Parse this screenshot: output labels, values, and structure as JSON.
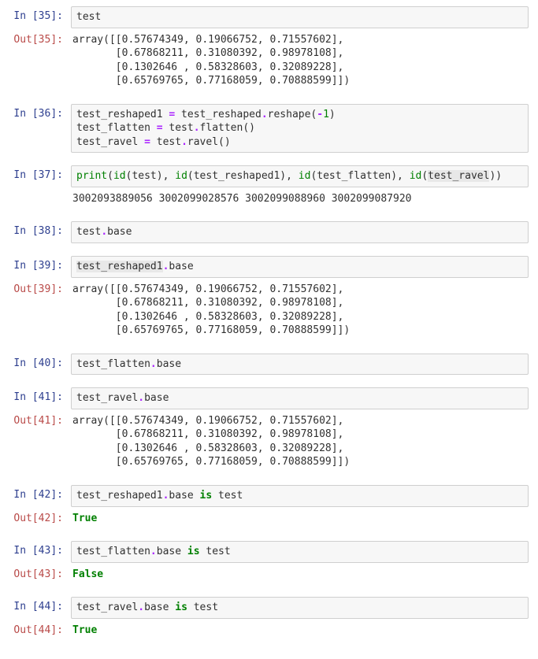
{
  "cells": [
    {
      "n": 35,
      "in_prompt": "In [35]:",
      "out_prompt": "Out[35]:",
      "code_tokens": [
        [
          "nm",
          "test"
        ]
      ],
      "output_tokens": [
        [
          "nm",
          "array([[0.57674349, 0.19066752, 0.71557602],\n       [0.67868211, 0.31080392, 0.98978108],\n       [0.1302646 , 0.58328603, 0.32089228],\n       [0.65769765, 0.77168059, 0.70888599]])"
        ]
      ]
    },
    {
      "n": 36,
      "in_prompt": "In [36]:",
      "code_tokens": [
        [
          "nm",
          "test_reshaped1 "
        ],
        [
          "op",
          "="
        ],
        [
          "nm",
          " test_reshaped"
        ],
        [
          "op",
          "."
        ],
        [
          "nm",
          "reshape("
        ],
        [
          "op",
          "-"
        ],
        [
          "num",
          "1"
        ],
        [
          "nm",
          ")\n"
        ],
        [
          "nm",
          "test_flatten "
        ],
        [
          "op",
          "="
        ],
        [
          "nm",
          " test"
        ],
        [
          "op",
          "."
        ],
        [
          "nm",
          "flatten()\n"
        ],
        [
          "nm",
          "test_ravel "
        ],
        [
          "op",
          "="
        ],
        [
          "nm",
          " test"
        ],
        [
          "op",
          "."
        ],
        [
          "nm",
          "ravel()"
        ]
      ]
    },
    {
      "n": 37,
      "in_prompt": "In [37]:",
      "code_tokens": [
        [
          "bi",
          "print"
        ],
        [
          "nm",
          "("
        ],
        [
          "bi",
          "id"
        ],
        [
          "nm",
          "(test), "
        ],
        [
          "bi",
          "id"
        ],
        [
          "nm",
          "(test_reshaped1), "
        ],
        [
          "bi",
          "id"
        ],
        [
          "nm",
          "(test_flatten), "
        ],
        [
          "bi",
          "id"
        ],
        [
          "nm",
          "("
        ],
        [
          "hl",
          "test_ravel"
        ],
        [
          "nm",
          "))"
        ]
      ],
      "stream_tokens": [
        [
          "nm",
          "3002093889056 3002099028576 3002099088960 3002099087920"
        ]
      ]
    },
    {
      "n": 38,
      "in_prompt": "In [38]:",
      "code_tokens": [
        [
          "nm",
          "test"
        ],
        [
          "op",
          "."
        ],
        [
          "nm",
          "base"
        ]
      ]
    },
    {
      "n": 39,
      "in_prompt": "In [39]:",
      "out_prompt": "Out[39]:",
      "code_tokens": [
        [
          "hl",
          "test_reshaped1"
        ],
        [
          "op",
          "."
        ],
        [
          "nm",
          "base"
        ]
      ],
      "output_tokens": [
        [
          "nm",
          "array([[0.57674349, 0.19066752, 0.71557602],\n       [0.67868211, 0.31080392, 0.98978108],\n       [0.1302646 , 0.58328603, 0.32089228],\n       [0.65769765, 0.77168059, 0.70888599]])"
        ]
      ]
    },
    {
      "n": 40,
      "in_prompt": "In [40]:",
      "code_tokens": [
        [
          "nm",
          "test_flatten"
        ],
        [
          "op",
          "."
        ],
        [
          "nm",
          "base"
        ]
      ]
    },
    {
      "n": 41,
      "in_prompt": "In [41]:",
      "out_prompt": "Out[41]:",
      "code_tokens": [
        [
          "nm",
          "test_ravel"
        ],
        [
          "op",
          "."
        ],
        [
          "nm",
          "base"
        ]
      ],
      "output_tokens": [
        [
          "nm",
          "array([[0.57674349, 0.19066752, 0.71557602],\n       [0.67868211, 0.31080392, 0.98978108],\n       [0.1302646 , 0.58328603, 0.32089228],\n       [0.65769765, 0.77168059, 0.70888599]])"
        ]
      ]
    },
    {
      "n": 42,
      "in_prompt": "In [42]:",
      "out_prompt": "Out[42]:",
      "code_tokens": [
        [
          "nm",
          "test_reshaped1"
        ],
        [
          "op",
          "."
        ],
        [
          "nm",
          "base "
        ],
        [
          "kw",
          "is"
        ],
        [
          "nm",
          " test"
        ]
      ],
      "output_tokens": [
        [
          "out-kw",
          "True"
        ]
      ]
    },
    {
      "n": 43,
      "in_prompt": "In [43]:",
      "out_prompt": "Out[43]:",
      "code_tokens": [
        [
          "nm",
          "test_flatten"
        ],
        [
          "op",
          "."
        ],
        [
          "nm",
          "base "
        ],
        [
          "kw",
          "is"
        ],
        [
          "nm",
          " test"
        ]
      ],
      "output_tokens": [
        [
          "out-kw",
          "False"
        ]
      ]
    },
    {
      "n": 44,
      "in_prompt": "In [44]:",
      "out_prompt": "Out[44]:",
      "code_tokens": [
        [
          "nm",
          "test_ravel"
        ],
        [
          "op",
          "."
        ],
        [
          "nm",
          "base "
        ],
        [
          "kw",
          "is"
        ],
        [
          "nm",
          " test"
        ]
      ],
      "output_tokens": [
        [
          "out-kw",
          "True"
        ]
      ]
    }
  ]
}
